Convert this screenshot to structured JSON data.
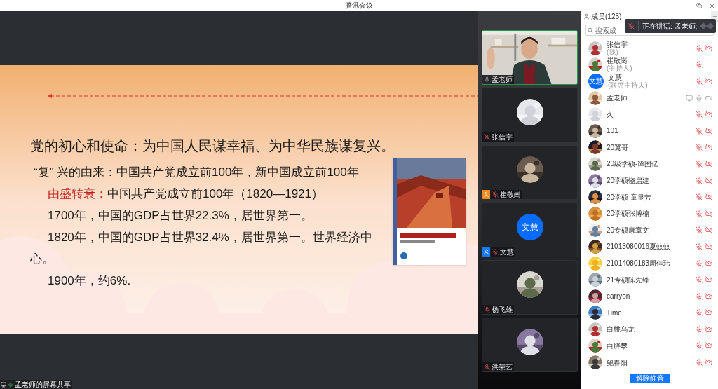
{
  "window": {
    "title": "腾讯会议"
  },
  "slide": {
    "lines": [
      {
        "kind": "title",
        "text": "党的初心和使命：为中国人民谋幸福、为中华民族谋复兴。"
      },
      {
        "kind": "heading",
        "text": "“复” 兴的由来：中国共产党成立前100年，新中国成立前100年"
      },
      {
        "kind": "point",
        "lead": "由盛转衰：",
        "text": "中国共产党成立前100年（1820—1921）"
      },
      {
        "kind": "point",
        "text": "1700年，中国的GDP占世界22.3%，居世界第一。"
      },
      {
        "kind": "point",
        "text": "1820年，中国的GDP占世界32.4%，居世界第一。世界经济中"
      },
      {
        "kind": "wrap",
        "text": "心。"
      },
      {
        "kind": "point",
        "text": "1900年，约6%."
      }
    ]
  },
  "share_label": "孟老师的屏幕共享",
  "video_tiles": [
    {
      "name": "孟老师",
      "video": true,
      "speaking": true,
      "mic_muted": false
    },
    {
      "name": "张信宇",
      "video": false,
      "speaking": false,
      "mic_muted": true
    },
    {
      "name": "崔敬崗",
      "video": false,
      "speaking": false,
      "mic_muted": true,
      "badge": {
        "color": "#f08a1c"
      }
    },
    {
      "name": "文慧",
      "video": false,
      "speaking": false,
      "mic_muted": true,
      "badge": {
        "color": "#1677ff"
      },
      "avatar_text": "文慧"
    },
    {
      "name": "杨飞雄",
      "video": false,
      "speaking": false,
      "mic_muted": true
    },
    {
      "name": "洪荣艺",
      "video": false,
      "speaking": false,
      "mic_muted": true
    }
  ],
  "members_panel": {
    "title": "成员(125)",
    "search": {
      "placeholder": "搜索成"
    },
    "speaking_toast": {
      "text": "正在讲话: 孟老师;"
    },
    "members": [
      {
        "name": "张信宇",
        "role": "(我)",
        "mic_muted": true,
        "camera_shown": true,
        "camera_on": false,
        "sharing": false
      },
      {
        "name": "崔敬崗",
        "role": "(主持人)",
        "mic_muted": true,
        "camera_shown": false,
        "sharing": false
      },
      {
        "name": "文慧",
        "role": "(联席主持人)",
        "avatar_text": "文慧",
        "mic_muted": true,
        "camera_shown": true,
        "camera_on": false,
        "sharing": false
      },
      {
        "name": "孟老师",
        "mic_muted": false,
        "camera_shown": true,
        "camera_on": true,
        "sharing": true
      },
      {
        "name": "久",
        "mic_muted": true,
        "camera_shown": true,
        "camera_on": false,
        "sharing": false
      },
      {
        "name": "101",
        "mic_muted": true,
        "camera_shown": true,
        "camera_on": false,
        "sharing": false
      },
      {
        "name": "20翼哥",
        "mic_muted": true,
        "camera_shown": true,
        "camera_on": false,
        "sharing": false
      },
      {
        "name": "20级学硕-谭国亿",
        "mic_muted": true,
        "camera_shown": true,
        "camera_on": false,
        "sharing": false
      },
      {
        "name": "20学硕饶启建",
        "mic_muted": true,
        "camera_shown": true,
        "camera_on": false,
        "sharing": false
      },
      {
        "name": "20学硕-童显芳",
        "mic_muted": true,
        "camera_shown": true,
        "camera_on": false,
        "sharing": false
      },
      {
        "name": "20学硕张博楠",
        "mic_muted": true,
        "camera_shown": true,
        "camera_on": false,
        "sharing": false
      },
      {
        "name": "20专硕康章文",
        "mic_muted": true,
        "camera_shown": true,
        "camera_on": false,
        "sharing": false
      },
      {
        "name": "21013080016夏蚊蚊",
        "mic_muted": true,
        "camera_shown": true,
        "camera_on": false,
        "sharing": false
      },
      {
        "name": "21014080183周佳玮",
        "mic_muted": true,
        "camera_shown": true,
        "camera_on": false,
        "sharing": false
      },
      {
        "name": "21专硕陈先锋",
        "mic_muted": true,
        "camera_shown": true,
        "camera_on": false,
        "sharing": false
      },
      {
        "name": "carryon",
        "mic_muted": true,
        "camera_shown": true,
        "camera_on": false,
        "sharing": false
      },
      {
        "name": "Time",
        "mic_muted": true,
        "camera_shown": true,
        "camera_on": false,
        "sharing": false
      },
      {
        "name": "白桃乌龙",
        "mic_muted": true,
        "camera_shown": true,
        "camera_on": false,
        "sharing": false
      },
      {
        "name": "白胖攀",
        "mic_muted": true,
        "camera_shown": true,
        "camera_on": false,
        "sharing": false
      },
      {
        "name": "鲍春阳",
        "mic_muted": true,
        "camera_shown": true,
        "camera_on": false,
        "sharing": false
      }
    ],
    "unmute_button": "解除静音"
  }
}
